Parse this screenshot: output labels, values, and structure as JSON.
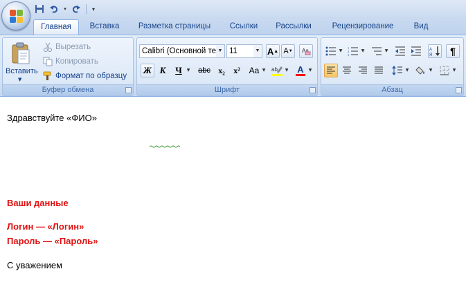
{
  "tabs": [
    "Главная",
    "Вставка",
    "Разметка страницы",
    "Ссылки",
    "Рассылки",
    "Рецензирование",
    "Вид"
  ],
  "clipboard": {
    "paste_label": "Вставить",
    "cut_label": "Вырезать",
    "copy_label": "Копировать",
    "format_label": "Формат по образцу",
    "group_label": "Буфер обмена"
  },
  "font": {
    "font_name": "Calibri (Основной те",
    "font_size": "11",
    "group_label": "Шрифт",
    "bold_glyph": "Ж",
    "italic_glyph": "К",
    "underline_glyph": "Ч",
    "strike_glyph": "abc",
    "subscript_glyph": "x₂",
    "superscript_glyph": "x²",
    "case_glyph": "Aa",
    "grow_glyph": "A",
    "shrink_glyph": "A",
    "color_glyph": "A",
    "highlight_color": "#ffff00",
    "font_color": "#ff0000"
  },
  "paragraph": {
    "group_label": "Абзац",
    "pilcrow": "¶"
  },
  "document": {
    "greeting": "Здравствуйте «ФИО»",
    "your_data": "Ваши данные",
    "login": "Логин  — «Логин»",
    "password": "Пароль — «Пароль»",
    "closing": "С уважением"
  }
}
